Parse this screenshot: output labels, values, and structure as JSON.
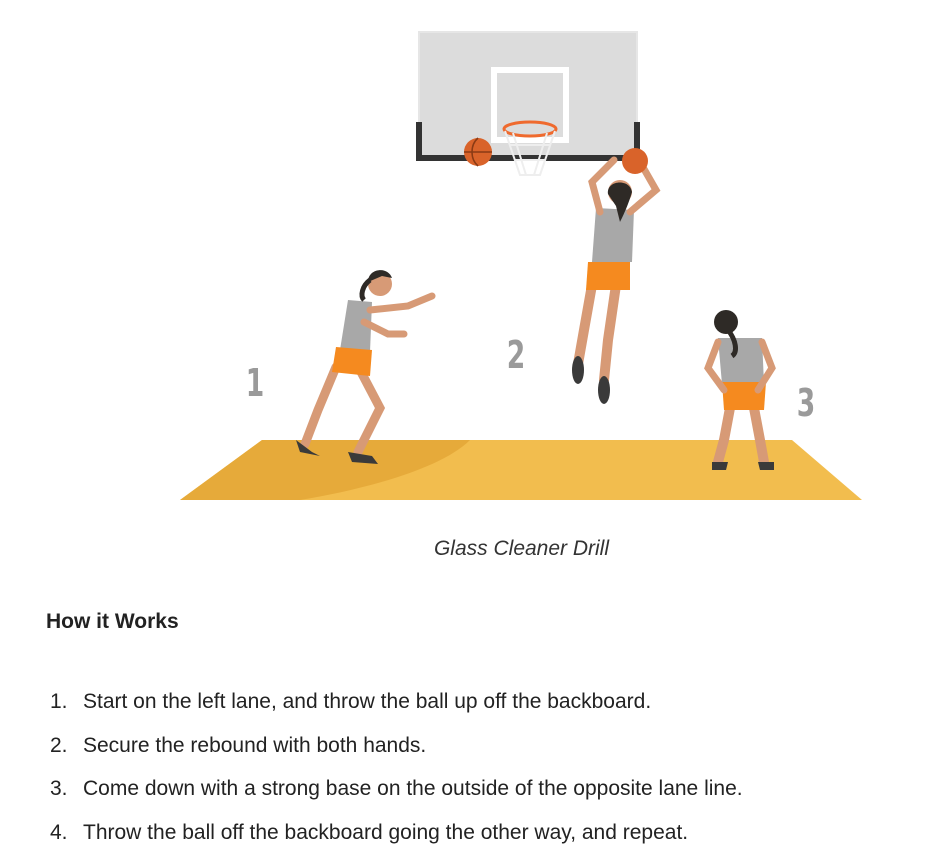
{
  "figure": {
    "position_labels": [
      "1",
      "2",
      "3"
    ],
    "colors": {
      "court": "#f2bd4e",
      "court_shade": "#e6aa3a",
      "backboard": "#dcdcdc",
      "backboard_frame": "#333333",
      "rim": "#ef6a2e",
      "ball": "#d9632a",
      "shirt": "#a8a8a8",
      "shorts": "#f58a1f",
      "skin": "#d79a76",
      "hair": "#2e2a26",
      "shoes": "#3a3a3a"
    }
  },
  "caption": "Glass Cleaner Drill",
  "section_heading": "How it Works",
  "steps": [
    {
      "number": "1.",
      "text": "Start on the left lane, and throw the ball up off the backboard."
    },
    {
      "number": "2.",
      "text": "Secure the rebound with both hands."
    },
    {
      "number": "3.",
      "text": "Come down with a strong base on the outside of the opposite lane line."
    },
    {
      "number": "4.",
      "text": "Throw the ball off the backboard going the other way, and repeat."
    }
  ]
}
